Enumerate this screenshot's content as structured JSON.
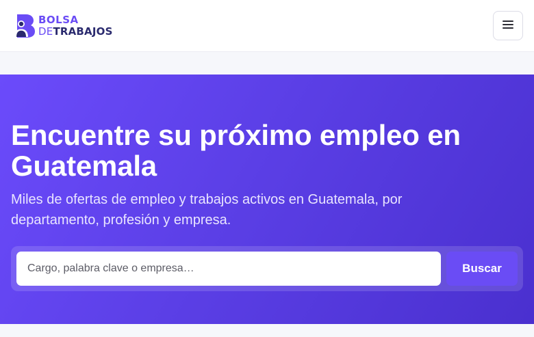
{
  "brand": {
    "line1": "BOLSA",
    "line2_prefix": "DE",
    "line2_main": "TRABAJOS",
    "primary_color": "#6a4cf5",
    "dark_color": "#2a2a6e"
  },
  "header": {
    "menu_icon": "hamburger-icon"
  },
  "hero": {
    "title": "Encuentre su próximo empleo en Guatemala",
    "subtitle": "Miles de ofertas de empleo y trabajos activos en Guatemala, por departamento, profesión y empresa.",
    "gradient_start": "#6b4bfb",
    "gradient_end": "#4a30cf"
  },
  "search": {
    "placeholder": "Cargo, palabra clave o empresa…",
    "value": "",
    "button_label": "Buscar"
  }
}
